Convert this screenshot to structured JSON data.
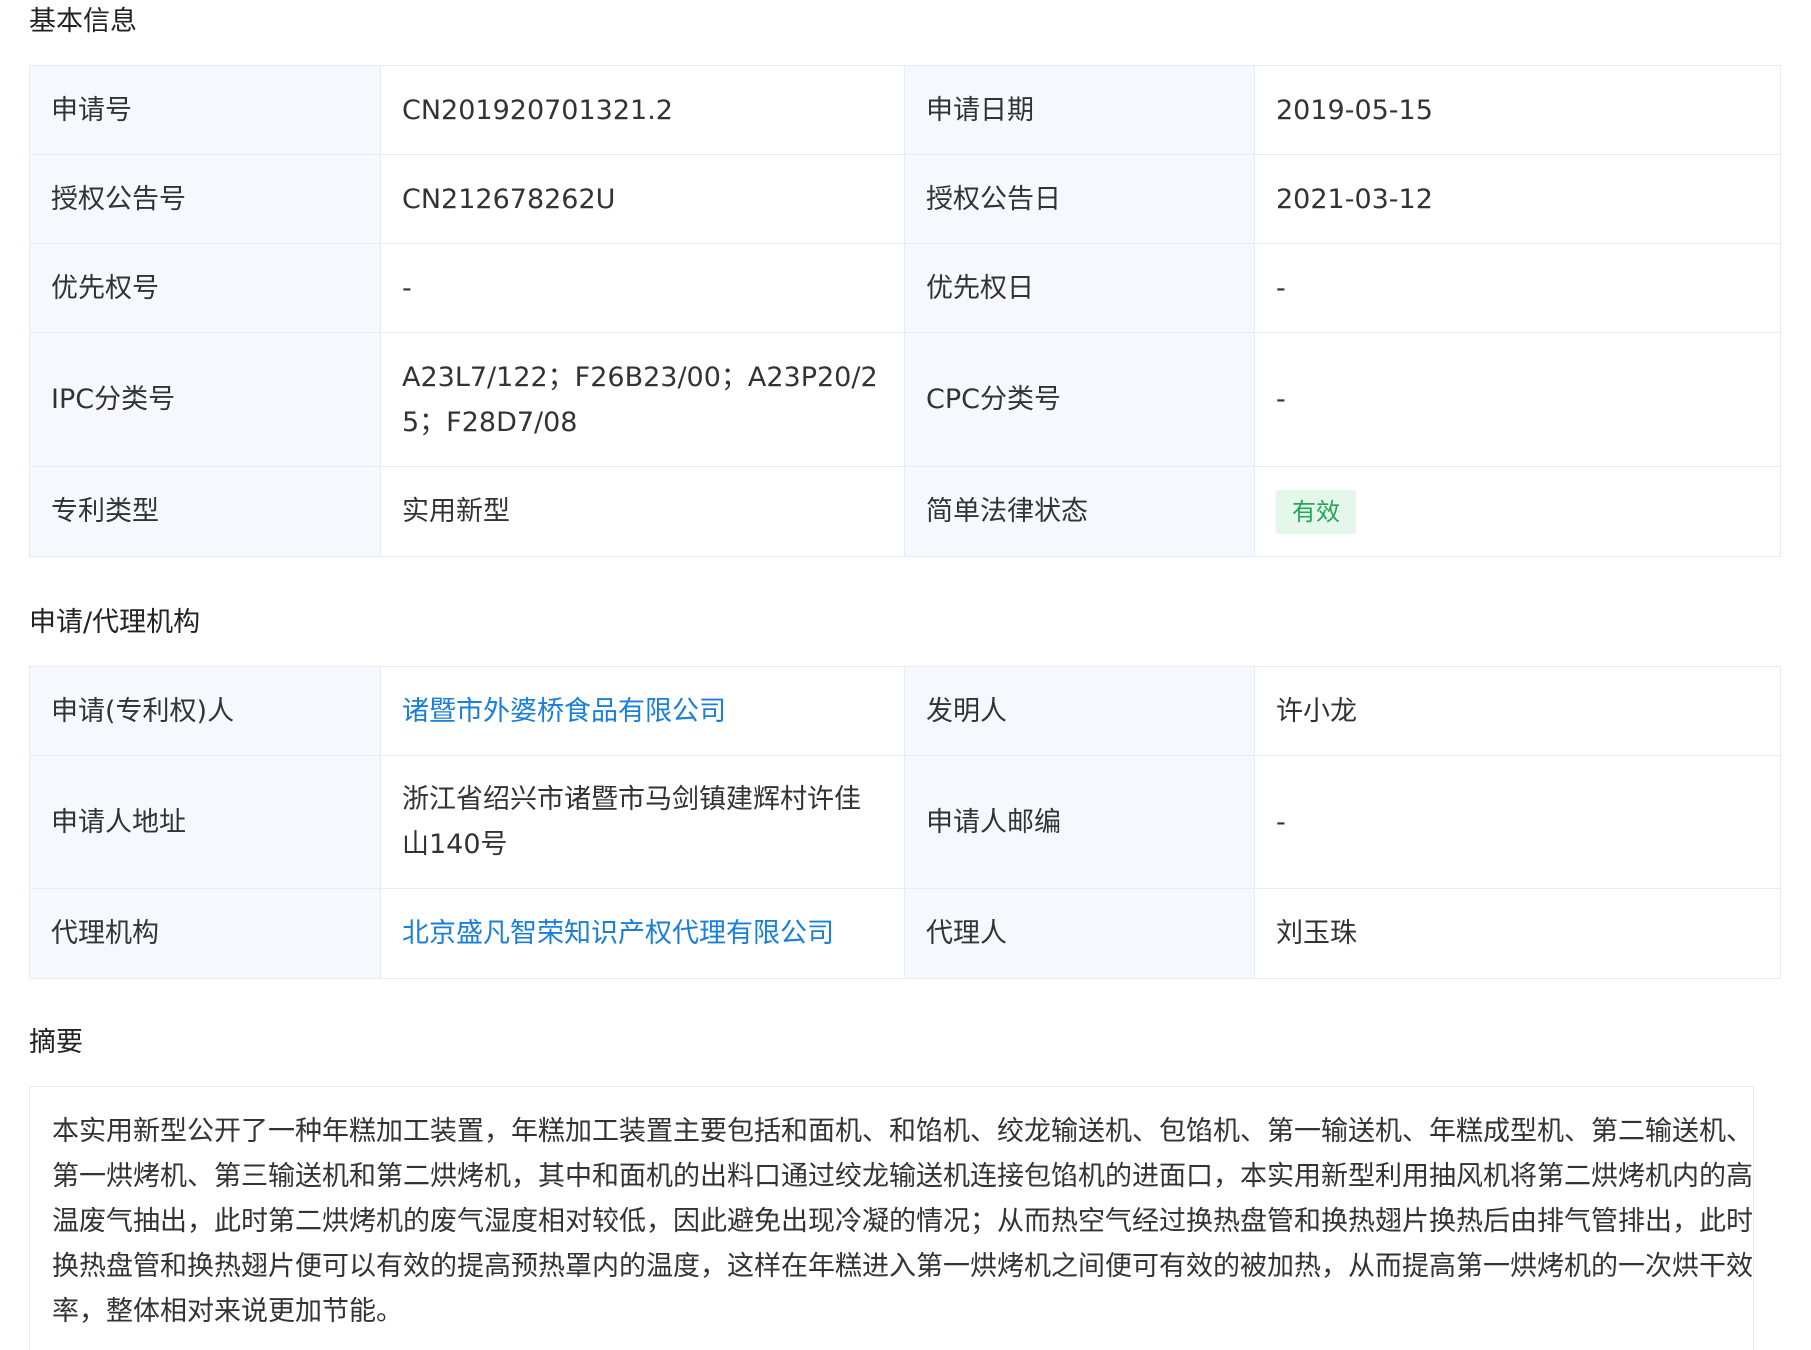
{
  "sections": {
    "basic_title": "基本信息",
    "agency_title": "申请/代理机构",
    "abstract_title": "摘要"
  },
  "basic": {
    "app_no_label": "申请号",
    "app_no": "CN201920701321.2",
    "app_date_label": "申请日期",
    "app_date": "2019-05-15",
    "grant_no_label": "授权公告号",
    "grant_no": "CN212678262U",
    "grant_date_label": "授权公告日",
    "grant_date": "2021-03-12",
    "priority_no_label": "优先权号",
    "priority_no": "-",
    "priority_date_label": "优先权日",
    "priority_date": "-",
    "ipc_label": "IPC分类号",
    "ipc": "A23L7/122；F26B23/00；A23P20/25；F28D7/08",
    "cpc_label": "CPC分类号",
    "cpc": "-",
    "type_label": "专利类型",
    "type": "实用新型",
    "status_label": "简单法律状态",
    "status": "有效"
  },
  "agency": {
    "applicant_label": "申请(专利权)人",
    "applicant": "诸暨市外婆桥食品有限公司",
    "inventor_label": "发明人",
    "inventor": "许小龙",
    "address_label": "申请人地址",
    "address": "浙江省绍兴市诸暨市马剑镇建辉村许佳山140号",
    "postcode_label": "申请人邮编",
    "postcode": "-",
    "agency_label": "代理机构",
    "agency": "北京盛凡智荣知识产权代理有限公司",
    "agent_label": "代理人",
    "agent": "刘玉珠"
  },
  "abstract": {
    "text": "本实用新型公开了一种年糕加工装置，年糕加工装置主要包括和面机、和馅机、绞龙输送机、包馅机、第一输送机、年糕成型机、第二输送机、第一烘烤机、第三输送机和第二烘烤机，其中和面机的出料口通过绞龙输送机连接包馅机的进面口，本实用新型利用抽风机将第二烘烤机内的高温废气抽出，此时第二烘烤机的废气湿度相对较低，因此避免出现冷凝的情况；从而热空气经过换热盘管和换热翅片换热后由排气管排出，此时换热盘管和换热翅片便可以有效的提高预热罩内的温度，这样在年糕进入第一烘烤机之间便可有效的被加热，从而提高第一烘烤机的一次烘干效率，整体相对来说更加节能。"
  },
  "colors": {
    "label_bg": "#f5f9fd",
    "border": "#e6ecf4",
    "link": "#1a7fd9",
    "status_bg": "#e5f6ea",
    "status_text": "#25a55a"
  }
}
